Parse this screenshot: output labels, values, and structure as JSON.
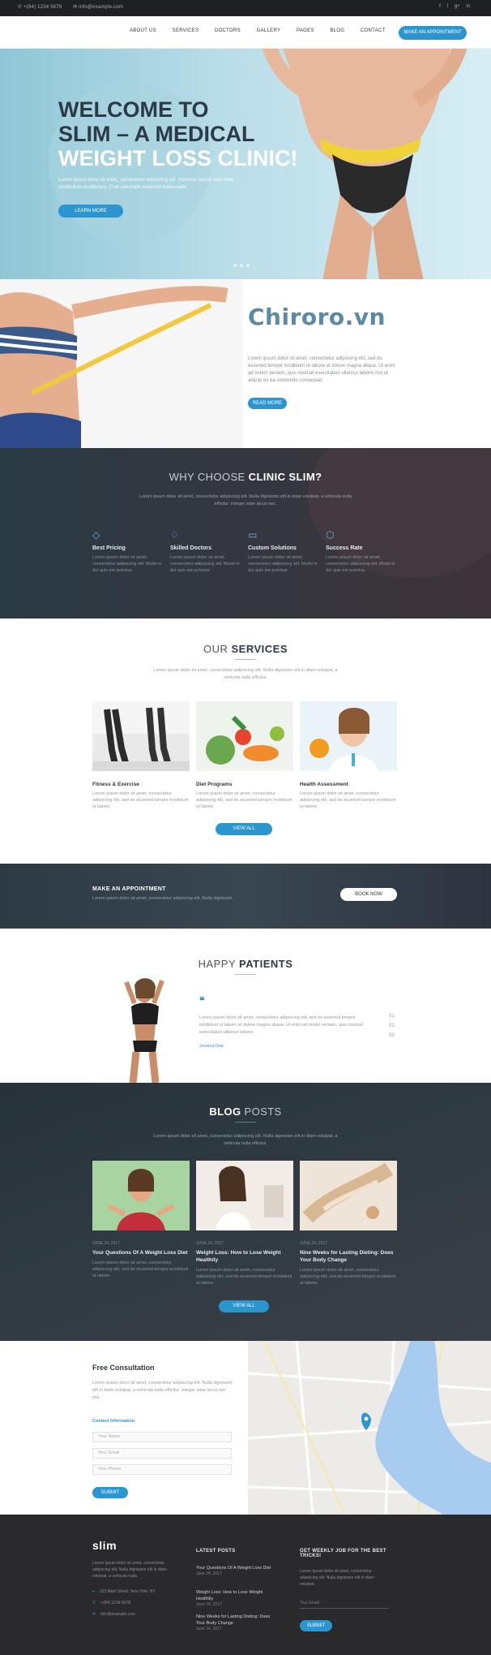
{
  "topbar": {
    "phone": "✆ +(84) 1234 5678",
    "email": "✉ info@example.com",
    "social": [
      "f",
      "t",
      "g+",
      "in"
    ]
  },
  "nav": {
    "items": [
      "ABOUT US",
      "SERVICES",
      "DOCTORS",
      "GALLERY",
      "PAGES",
      "BLOG",
      "CONTACT"
    ],
    "appointment_label": "MAKE AN APPOINTMENT"
  },
  "hero": {
    "title_line1": "WELCOME TO",
    "title_line2": "SLIM – A MEDICAL",
    "title_line3": "WEIGHT LOSS CLINIC!",
    "lead": "Lorem ipsum dolor sit amet, consectetur adipiscing elit. Vivamus lacinia odio vitae vestibulum vestibulum. Cras venenatis euismod malesuada.",
    "button": "LEARN MORE"
  },
  "about": {
    "watermark": "Chiroro.vn",
    "text": "Lorem ipsum dolor sit amet, consectetur adipiscing elit, sed do eiusmod tempor incididunt ut labore et dolore magna aliqua. Ut enim ad minim veniam, quis nostrud exercitation ullamco laboris nisi ut aliquip ex ea commodo consequat.",
    "button": "READ MORE"
  },
  "why": {
    "title_light": "WHY CHOOSE",
    "title_bold": "CLINIC SLIM?",
    "subtitle": "Lorem ipsum dolor sit amet, consectetur adipiscing elit. Nulla dignissim elit in diam volutpat, a vehicula nulla efficitur. Integer vitae lacus nec.",
    "features": [
      {
        "icon": "tag-icon",
        "glyph": "◇",
        "title": "Best Pricing",
        "text": "Lorem ipsum dolor sit amet, consectetur adipiscing elit. Morbi in dui quis est pulvinar."
      },
      {
        "icon": "diamond-icon",
        "glyph": "♢",
        "title": "Skilled Doctors",
        "text": "Lorem ipsum dolor sit amet, consectetur adipiscing elit. Morbi in dui quis est pulvinar."
      },
      {
        "icon": "document-icon",
        "glyph": "▭",
        "title": "Custom Solutions",
        "text": "Lorem ipsum dolor sit amet, consectetur adipiscing elit. Morbi in dui quis est pulvinar."
      },
      {
        "icon": "badge-icon",
        "glyph": "⬡",
        "title": "Success Rate",
        "text": "Lorem ipsum dolor sit amet, consectetur adipiscing elit. Morbi in dui quis est pulvinar."
      }
    ]
  },
  "services": {
    "title_light": "OUR",
    "title_bold": "SERVICES",
    "subtitle": "Lorem ipsum dolor sit amet, consectetur adipiscing elit. Nulla dignissim elit in diam volutpat, a vehicula nulla efficitur.",
    "items": [
      {
        "title": "Fitness & Exercise",
        "text": "Lorem ipsum dolor sit amet, consectetur adipiscing elit, sed do eiusmod tempor incididunt ut labore."
      },
      {
        "title": "Diet Programs",
        "text": "Lorem ipsum dolor sit amet, consectetur adipiscing elit, sed do eiusmod tempor incididunt ut labore."
      },
      {
        "title": "Health Assessment",
        "text": "Lorem ipsum dolor sit amet, consectetur adipiscing elit, sed do eiusmod tempor incididunt ut labore."
      }
    ],
    "button": "VIEW ALL"
  },
  "appointment": {
    "title": "MAKE AN APPOINTMENT",
    "text": "Lorem ipsum dolor sit amet, consectetur adipiscing elit. Nulla dignissim.",
    "button": "BOOK NOW"
  },
  "patients": {
    "title_light": "HAPPY",
    "title_bold": "PATIENTS",
    "quote_mark": "❝",
    "text": "Lorem ipsum dolor sit amet, consectetur adipiscing elit, sed do eiusmod tempor incididunt ut labore et dolore magna aliqua. Ut enim ad minim veniam, quis nostrud exercitation ullamco laboris.",
    "name": "Jessica Doe",
    "pager": [
      "01",
      "02",
      "03"
    ]
  },
  "blog": {
    "title_bold": "BLOG",
    "title_light": "POSTS",
    "subtitle": "Lorem ipsum dolor sit amet, consectetur adipiscing elit. Nulla dignissim elit in diam volutpat, a vehicula nulla efficitur.",
    "posts": [
      {
        "meta": "JUNE 24, 2017",
        "title": "Your Questions Of A Weight Loss Diet",
        "text": "Lorem ipsum dolor sit amet, consectetur adipiscing elit, sed do eiusmod tempor incididunt ut labore."
      },
      {
        "meta": "JUNE 24, 2017",
        "title": "Weight Loss: How to Lose Weight Healthily",
        "text": "Lorem ipsum dolor sit amet, consectetur adipiscing elit, sed do eiusmod tempor incididunt ut labore."
      },
      {
        "meta": "JUNE 24, 2017",
        "title": "Nine Weeks for Lasting Dieting: Does Your Body Change",
        "text": "Lorem ipsum dolor sit amet, consectetur adipiscing elit, sed do eiusmod tempor incididunt ut labore."
      }
    ],
    "button": "VIEW ALL"
  },
  "consultation": {
    "title": "Free Consultation",
    "text": "Lorem ipsum dolor sit amet, consectetur adipiscing elit. Nulla dignissim elit in diam volutpat, a vehicula nulla efficitur. Integer vitae lacus nec nisl.",
    "form_label": "Contact Information",
    "fields": [
      "Your Name",
      "Your Email",
      "Your Phone"
    ],
    "button": "SUBMIT"
  },
  "footer": {
    "logo": "slim",
    "about": "Lorem ipsum dolor sit amet, consectetur adipiscing elit. Nulla dignissim elit in diam volutpat, a vehicula nulla.",
    "contacts": [
      {
        "icon": "map-pin-icon",
        "glyph": "⌖",
        "text": "123 Main Street, New York, NY"
      },
      {
        "icon": "phone-icon",
        "glyph": "✆",
        "text": "+(84) 1234 5678"
      },
      {
        "icon": "mail-icon",
        "glyph": "✉",
        "text": "info@example.com"
      }
    ],
    "latest_title": "LATEST POSTS",
    "latest": [
      {
        "title": "Your Questions Of A Weight Loss Diet",
        "date": "June 24, 2017"
      },
      {
        "title": "Weight Loss: How to Lose Weight Healthily",
        "date": "June 24, 2017"
      },
      {
        "title": "Nine Weeks for Lasting Dieting: Does Your Body Change",
        "date": "June 24, 2017"
      }
    ],
    "newsletter_title": "GET WEEKLY JOB FOR THE BEST TRICKS!",
    "newsletter_text": "Lorem ipsum dolor sit amet, consectetur adipiscing elit. Nulla dignissim elit in diam volutpat.",
    "newsletter_placeholder": "Your Email",
    "newsletter_button": "SUBMIT"
  },
  "colors": {
    "accent": "#2b95d0",
    "dark": "#2c3a48",
    "footer": "#2a2a2c"
  }
}
